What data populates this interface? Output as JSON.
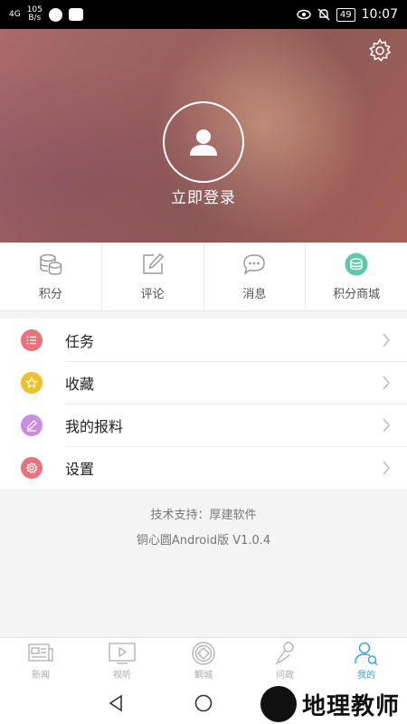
{
  "status_bar": {
    "signal": "4G",
    "net_speed_value": "105",
    "net_speed_unit": "B/s",
    "battery": "49",
    "time": "10:07"
  },
  "profile": {
    "login_label": "立即登录",
    "settings_icon": "gear-icon",
    "avatar_icon": "user-icon"
  },
  "quick_actions": [
    {
      "label": "积分",
      "icon": "coins-icon"
    },
    {
      "label": "评论",
      "icon": "edit-icon"
    },
    {
      "label": "消息",
      "icon": "chat-icon"
    },
    {
      "label": "积分商城",
      "icon": "store-icon"
    }
  ],
  "menu": [
    {
      "label": "任务",
      "icon": "list-icon",
      "color": "#e9737a"
    },
    {
      "label": "收藏",
      "icon": "star-icon",
      "color": "#efc02a"
    },
    {
      "label": "我的报料",
      "icon": "pen-icon",
      "color": "#c98ee0"
    },
    {
      "label": "设置",
      "icon": "gear-icon",
      "color": "#e9737a"
    }
  ],
  "footer": {
    "support": "技术支持：厚建软件",
    "version": "铜心圆Android版 V1.0.4"
  },
  "tabs": [
    {
      "label": "新闻",
      "icon": "newspaper-icon",
      "active": false
    },
    {
      "label": "视听",
      "icon": "video-icon",
      "active": false
    },
    {
      "label": "鲷城",
      "icon": "coin-icon",
      "active": false
    },
    {
      "label": "问政",
      "icon": "microphone-icon",
      "active": false
    },
    {
      "label": "我的",
      "icon": "profile-icon",
      "active": true
    }
  ],
  "watermark": {
    "text": "地理教师"
  },
  "colors": {
    "accent": "#36a7dd",
    "store_green": "#5ccaa6"
  }
}
